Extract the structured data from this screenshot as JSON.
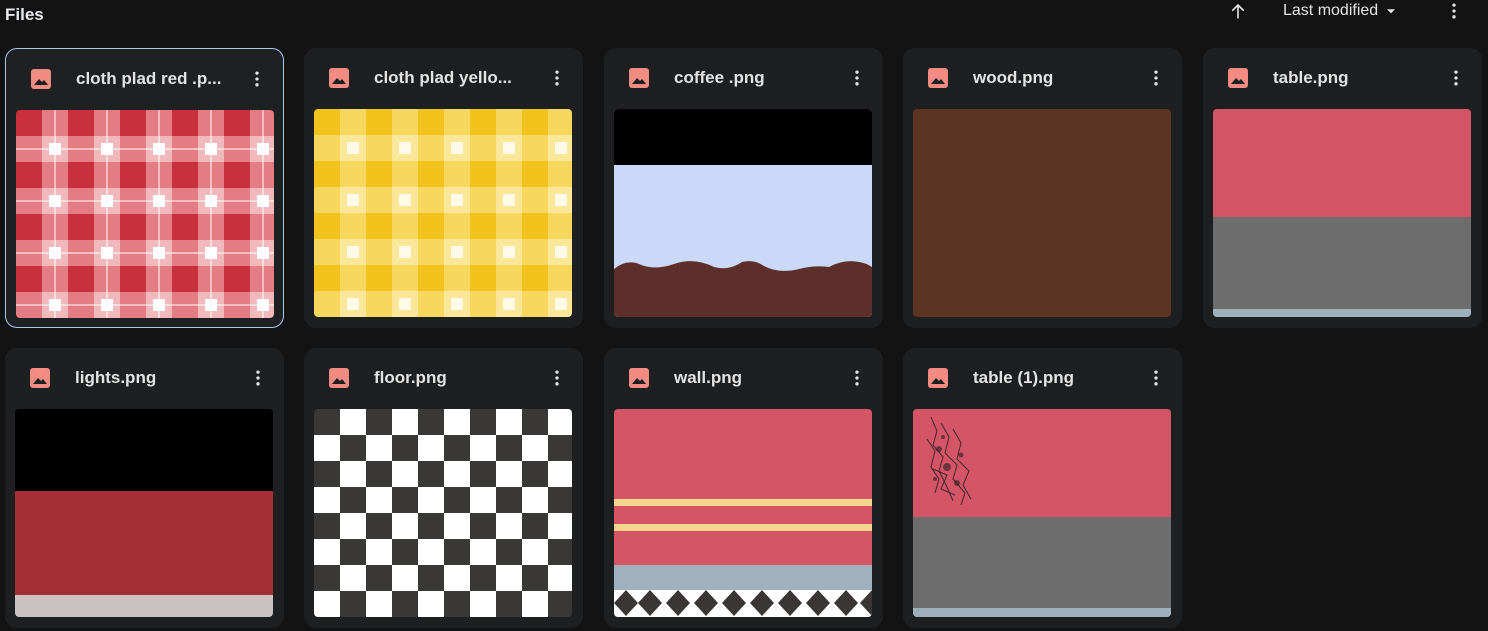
{
  "header": {
    "title": "Files",
    "sort_label": "Last modified",
    "sort_direction_icon": "arrow-up-icon",
    "more_icon": "more-vert-icon"
  },
  "files": [
    {
      "name": "cloth plad red .p...",
      "selected": true
    },
    {
      "name": "cloth plad yello..."
    },
    {
      "name": "coffee .png"
    },
    {
      "name": "wood.png"
    },
    {
      "name": "table.png"
    },
    {
      "name": "lights.png"
    },
    {
      "name": "floor.png"
    },
    {
      "name": "wall.png"
    },
    {
      "name": "table (1).png"
    }
  ],
  "colors": {
    "background": "#131314",
    "card": "#1e1f20",
    "image_icon": "#f28b82",
    "selected_border": "#a8c7fa"
  }
}
